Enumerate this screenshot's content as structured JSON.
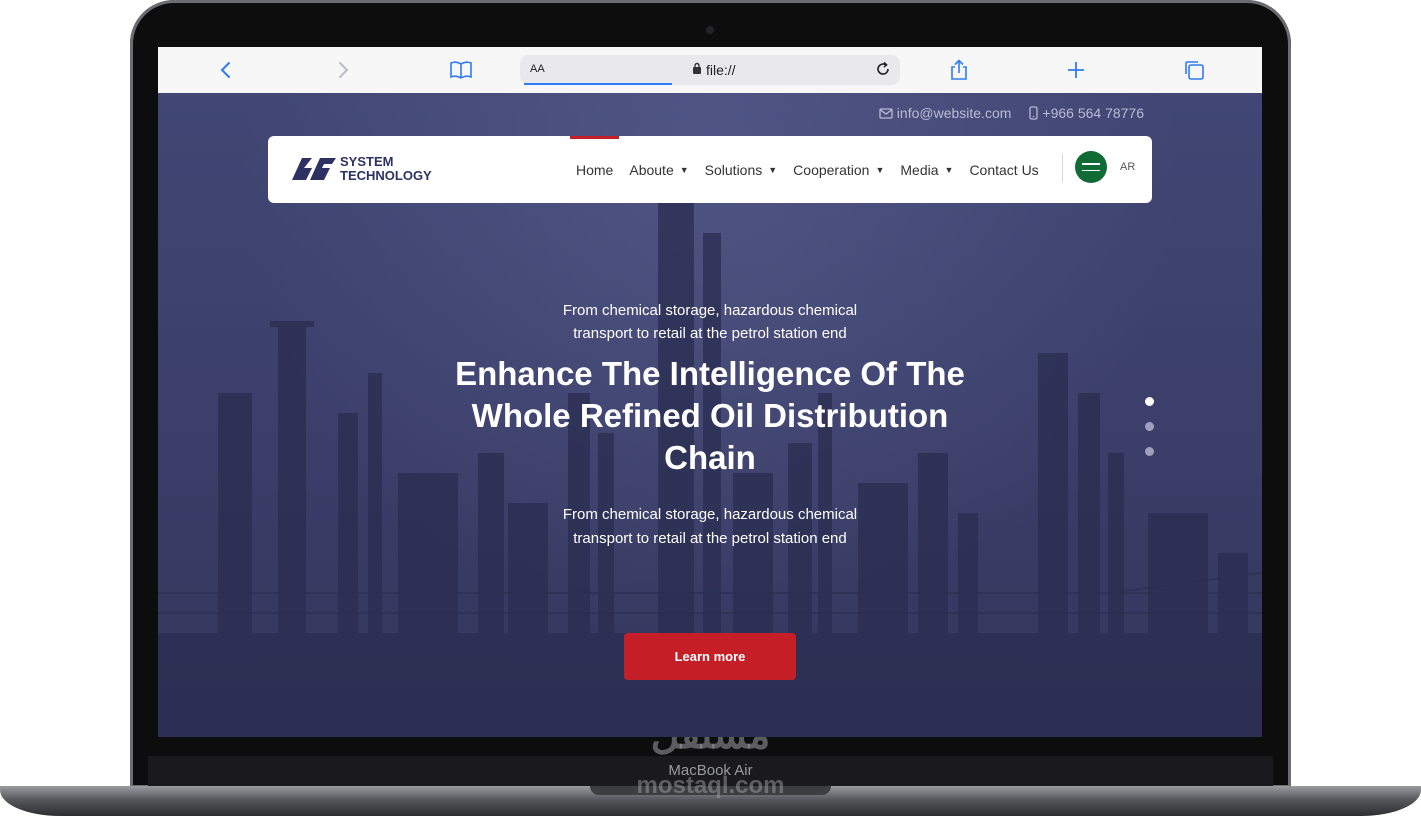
{
  "device": {
    "model_label": "MacBook Air"
  },
  "watermark": {
    "brand": "مستقل",
    "domain": "mostaql.com"
  },
  "browser": {
    "reader_label": "AA",
    "url": "file://",
    "icons": [
      "chevron-left-icon",
      "chevron-right-icon",
      "bookmarks-icon",
      "lock-icon",
      "reload-icon",
      "share-icon",
      "plus-icon",
      "tabs-icon"
    ]
  },
  "topbar": {
    "email": "info@website.com",
    "phone": "+966 564 78776"
  },
  "navbar": {
    "logo_line1": "SYSTEM",
    "logo_line2": "TECHNOLOGY",
    "items": [
      {
        "label": "Home",
        "dropdown": false,
        "active": true
      },
      {
        "label": "Aboute",
        "dropdown": true,
        "active": false
      },
      {
        "label": "Solutions",
        "dropdown": true,
        "active": false
      },
      {
        "label": "Cooperation",
        "dropdown": true,
        "active": false
      },
      {
        "label": "Media",
        "dropdown": true,
        "active": false
      },
      {
        "label": "Contact Us",
        "dropdown": false,
        "active": false
      }
    ],
    "language": "AR",
    "accent_color": "#c41f27"
  },
  "hero": {
    "subtitle_top": "From chemical storage, hazardous chemical transport to retail at the petrol station end",
    "title": "Enhance The Intelligence Of The Whole Refined Oil Distribution Chain",
    "subtitle_bottom": "From chemical storage, hazardous chemical transport to retail at the petrol station end",
    "cta_label": "Learn more",
    "slide_count": 3,
    "active_slide": 1
  }
}
